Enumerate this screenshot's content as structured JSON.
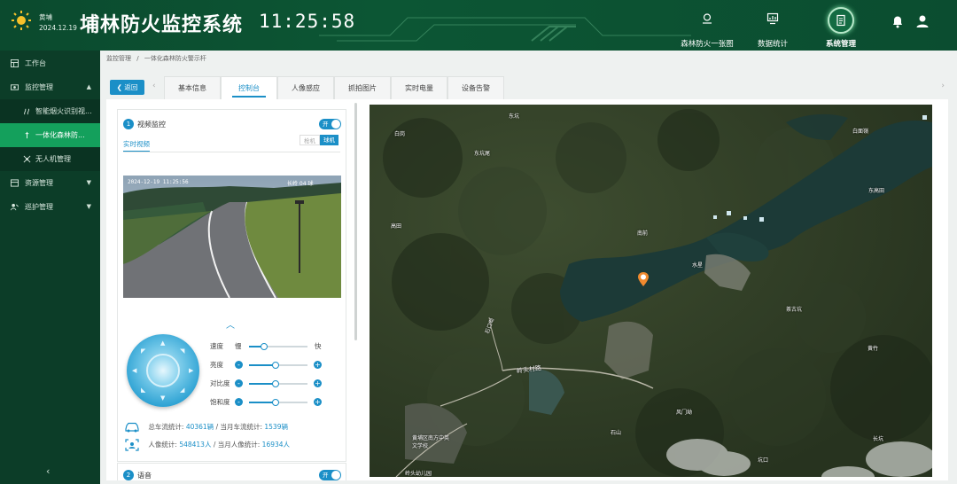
{
  "header": {
    "location": "黄埔",
    "date": "2024.12.19",
    "title": "埔林防火监控系统",
    "time": "11:25:58",
    "nav": [
      {
        "label": "森林防火一张图"
      },
      {
        "label": "数据统计"
      },
      {
        "label": "系统管理"
      }
    ]
  },
  "sidebar": {
    "items": [
      {
        "label": "工作台"
      },
      {
        "label": "监控管理"
      },
      {
        "label": "智能烟火识别视..."
      },
      {
        "label": "一体化森林防..."
      },
      {
        "label": "无人机管理"
      },
      {
        "label": "资源管理"
      },
      {
        "label": "巡护管理"
      }
    ]
  },
  "breadcrumb": [
    "监控管理",
    "/",
    "一体化森林防火警示杆"
  ],
  "tabs": {
    "back": "返回",
    "items": [
      "基本信息",
      "控制台",
      "人像感应",
      "抓拍图片",
      "实时电量",
      "设备告警"
    ],
    "active": 1
  },
  "control": {
    "section1": {
      "num": "1",
      "title": "视频监控",
      "toggle": "开"
    },
    "subtab": "实时视频",
    "segments": {
      "off": "枪机",
      "on": "球机"
    },
    "video": {
      "timestamp": "2024-12-19 11:25:56",
      "camera": "长岭 04 球"
    },
    "sliders": [
      {
        "label": "速度",
        "min": "慢",
        "max": "快",
        "value": 0.25,
        "buttons": false
      },
      {
        "label": "亮度",
        "value": 0.45,
        "buttons": true
      },
      {
        "label": "对比度",
        "value": 0.45,
        "buttons": true
      },
      {
        "label": "饱和度",
        "value": 0.45,
        "buttons": true
      }
    ],
    "stats": {
      "vehicle_total_label": "总车流统计:",
      "vehicle_total": "40361辆",
      "vehicle_month_label": "/ 当月车流统计:",
      "vehicle_month": "1539辆",
      "person_total_label": "人像统计:",
      "person_total": "548413人",
      "person_month_label": "/ 当月人像统计:",
      "person_month": "16934人"
    },
    "section2": {
      "num": "2",
      "title": "语音",
      "toggle": "开"
    }
  },
  "map": {
    "labels": [
      {
        "text": "东坑"
      },
      {
        "text": "白岗"
      },
      {
        "text": "东坑尾"
      },
      {
        "text": "白面嶺"
      },
      {
        "text": "高田"
      },
      {
        "text": "南前"
      },
      {
        "text": "东高田"
      },
      {
        "text": "水星"
      },
      {
        "text": "茶古坑"
      },
      {
        "text": "黄竹"
      },
      {
        "text": "风门坳"
      },
      {
        "text": "石山"
      },
      {
        "text": "长坑"
      },
      {
        "text": "石口坳"
      },
      {
        "text": "岭头村路"
      },
      {
        "text": "黄埔区南方中英文学校"
      },
      {
        "text": "岭头幼儿园"
      },
      {
        "text": "坑口"
      }
    ]
  },
  "colors": {
    "brand": "#0c5634",
    "accent": "#1b8fc7",
    "sidebar_active": "#14a05c"
  }
}
